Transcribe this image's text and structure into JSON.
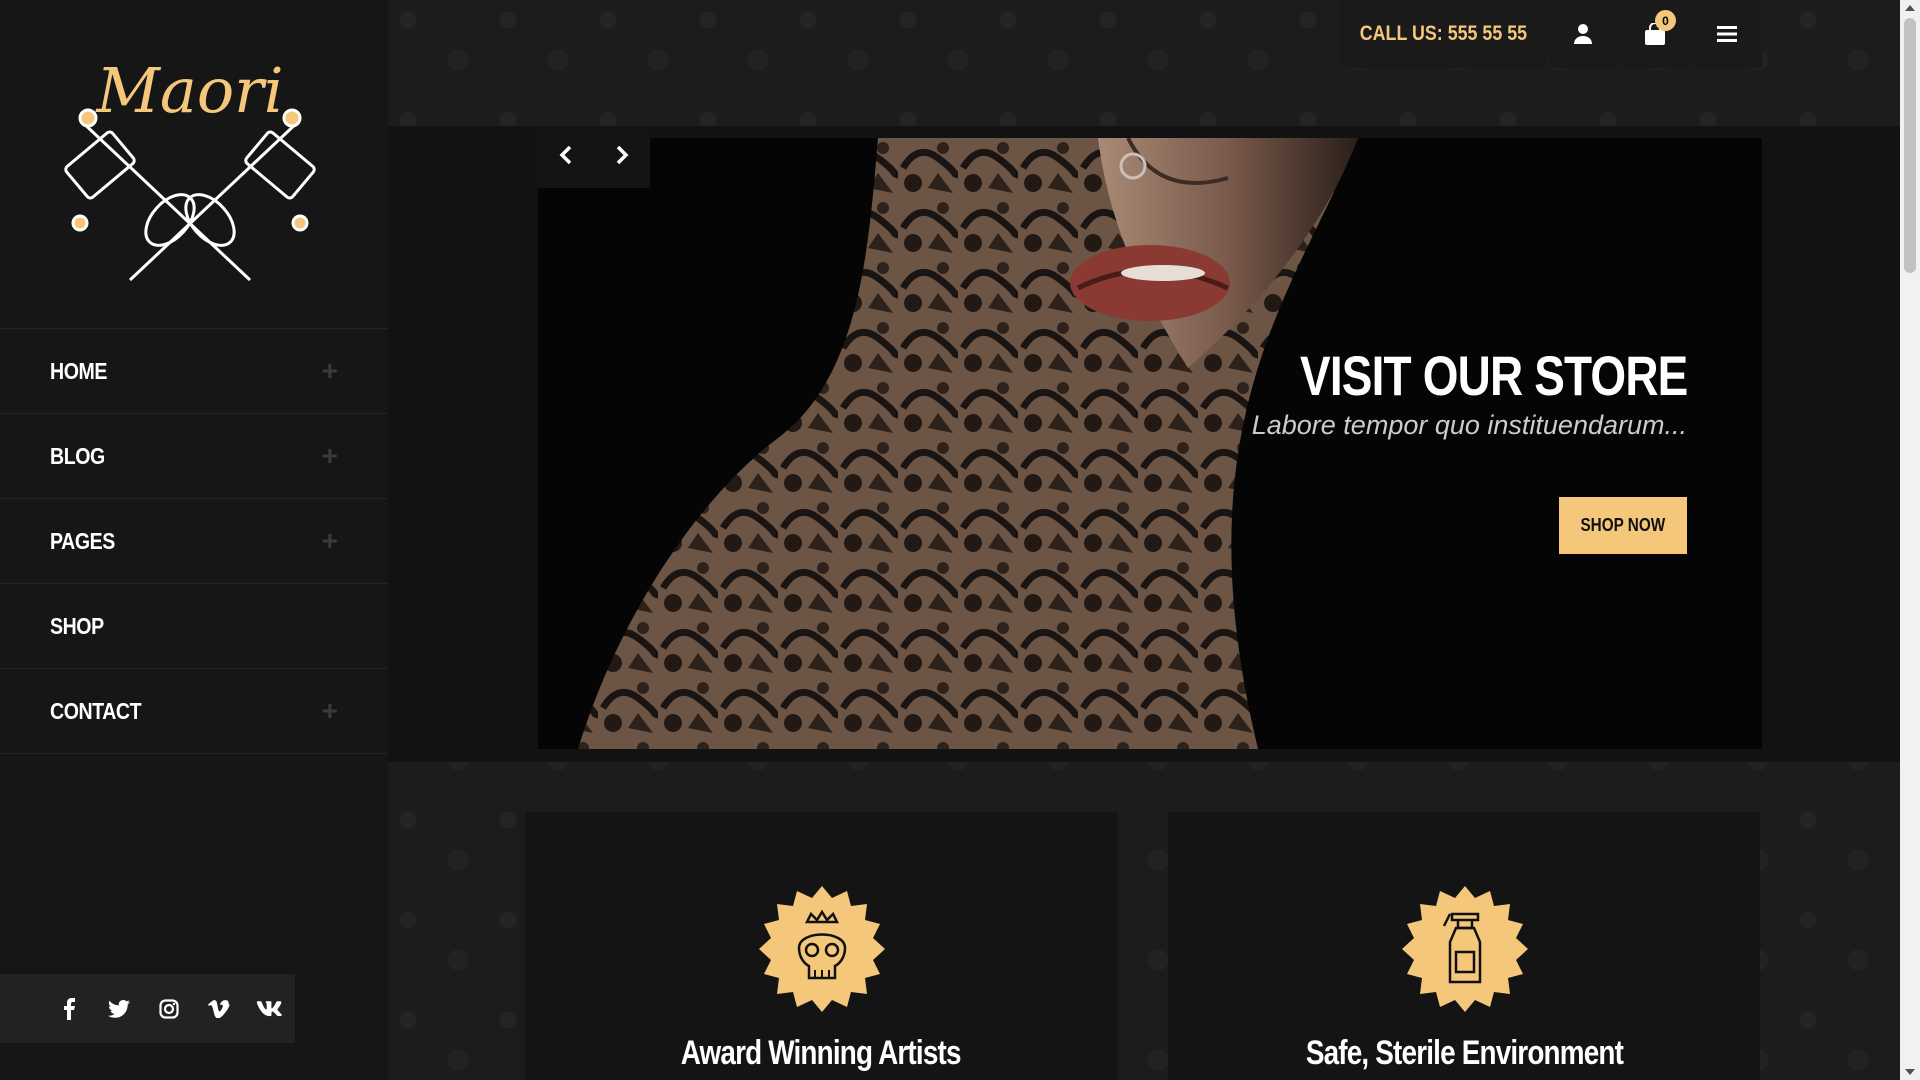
{
  "brand": {
    "logo_text": "Maori"
  },
  "nav": {
    "items": [
      {
        "label": "HOME",
        "expandable": true
      },
      {
        "label": "BLOG",
        "expandable": true
      },
      {
        "label": "PAGES",
        "expandable": true
      },
      {
        "label": "SHOP",
        "expandable": false
      },
      {
        "label": "CONTACT",
        "expandable": true
      }
    ],
    "expand_icon": "plus-icon"
  },
  "social": [
    "facebook-icon",
    "twitter-icon",
    "instagram-icon",
    "vimeo-icon",
    "vk-icon"
  ],
  "topbar": {
    "call_label": "CALL US: 555 55 55",
    "cart_count": "0",
    "icons": [
      "user-icon",
      "cart-icon",
      "menu-icon"
    ]
  },
  "hero": {
    "headline": "VISIT OUR STORE",
    "subtext": "Labore tempor quo instituendarum...",
    "cta_label": "SHOP NOW"
  },
  "features": [
    {
      "title": "Award Winning Artists",
      "icon": "skull-crown-icon"
    },
    {
      "title": "Safe, Sterile Environment",
      "icon": "spray-bottle-icon"
    }
  ],
  "colors": {
    "accent": "#f4c77a",
    "sidebar": "#161616",
    "background": "#1e1e1e"
  }
}
